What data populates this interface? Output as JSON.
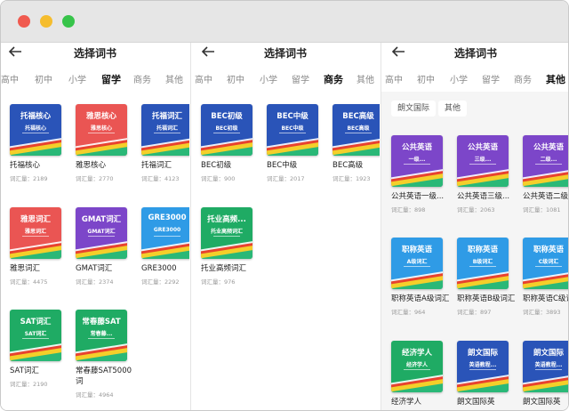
{
  "nav": {
    "title": "选择词书"
  },
  "tabs": [
    "高中",
    "初中",
    "小学",
    "留学",
    "商务",
    "其他"
  ],
  "panel1": {
    "active_tab": "留学",
    "books": [
      {
        "cover1": "托福核心",
        "cover2": "托福核心",
        "name": "托福核心",
        "count": "词汇量：2189",
        "color": "#2a54b8"
      },
      {
        "cover1": "雅思核心",
        "cover2": "雅思核心",
        "name": "雅思核心",
        "count": "词汇量：2770",
        "color": "#ea5553"
      },
      {
        "cover1": "托福词汇",
        "cover2": "托福词汇",
        "name": "托福词汇",
        "count": "词汇量：4123",
        "color": "#2a54b8"
      },
      {
        "cover1": "雅思词汇",
        "cover2": "雅思词汇",
        "name": "雅思词汇",
        "count": "词汇量：4475",
        "color": "#ea5553"
      },
      {
        "cover1": "GMAT词汇",
        "cover2": "GMAT词汇",
        "name": "GMAT词汇",
        "count": "词汇量：2374",
        "color": "#7c46c9"
      },
      {
        "cover1": "GRE3000",
        "cover2": "GRE3000",
        "name": "GRE3000",
        "count": "词汇量：2292",
        "color": "#2f9be6"
      },
      {
        "cover1": "SAT词汇",
        "cover2": "SAT词汇",
        "name": "SAT词汇",
        "count": "词汇量：2190",
        "color": "#1fab64"
      },
      {
        "cover1": "常春藤SAT",
        "cover2": "常春藤...",
        "name": "常春藤SAT5000词",
        "count": "词汇量：4964",
        "color": "#1fab64"
      }
    ]
  },
  "panel2": {
    "active_tab": "商务",
    "books": [
      {
        "cover1": "BEC初级",
        "cover2": "BEC初级",
        "name": "BEC初级",
        "count": "词汇量：900",
        "color": "#2a54b8"
      },
      {
        "cover1": "BEC中级",
        "cover2": "BEC中级",
        "name": "BEC中级",
        "count": "词汇量：2017",
        "color": "#2a54b8"
      },
      {
        "cover1": "BEC高级",
        "cover2": "BEC高级",
        "name": "BEC高级",
        "count": "词汇量：1923",
        "color": "#2a54b8"
      },
      {
        "cover1": "托业高频...",
        "cover2": "托业高频词汇",
        "name": "托业高频词汇",
        "count": "词汇量：976",
        "color": "#1fab64"
      }
    ]
  },
  "panel3": {
    "active_tab": "其他",
    "chips": [
      "朗文国际",
      "其他"
    ],
    "books": [
      {
        "cover1": "公共英语",
        "cover2": "一级...",
        "name": "公共英语一级...",
        "count": "词汇量：898",
        "color": "#7c46c9"
      },
      {
        "cover1": "公共英语",
        "cover2": "三级...",
        "name": "公共英语三级...",
        "count": "词汇量：2063",
        "color": "#7c46c9"
      },
      {
        "cover1": "公共英语",
        "cover2": "二级...",
        "name": "公共英语二级...",
        "count": "词汇量：1081",
        "color": "#7c46c9"
      },
      {
        "cover1": "职称英语",
        "cover2": "A级词汇",
        "name": "职称英语A级词汇",
        "count": "词汇量：964",
        "color": "#2f9be6"
      },
      {
        "cover1": "职称英语",
        "cover2": "B级词汇",
        "name": "职称英语B级词汇",
        "count": "词汇量：897",
        "color": "#2f9be6"
      },
      {
        "cover1": "职称英语",
        "cover2": "C级词汇",
        "name": "职称英语C级词汇",
        "count": "词汇量：3893",
        "color": "#2f9be6"
      },
      {
        "cover1": "经济学人",
        "cover2": "经济学人",
        "name": "经济学人",
        "count": "",
        "color": "#1fab64"
      },
      {
        "cover1": "朗文国际",
        "cover2": "英语教程...",
        "name": "朗文国际英",
        "count": "",
        "color": "#2a54b8"
      },
      {
        "cover1": "朗文国际",
        "cover2": "英语教程...",
        "name": "朗文国际英",
        "count": "",
        "color": "#2a54b8"
      }
    ]
  }
}
